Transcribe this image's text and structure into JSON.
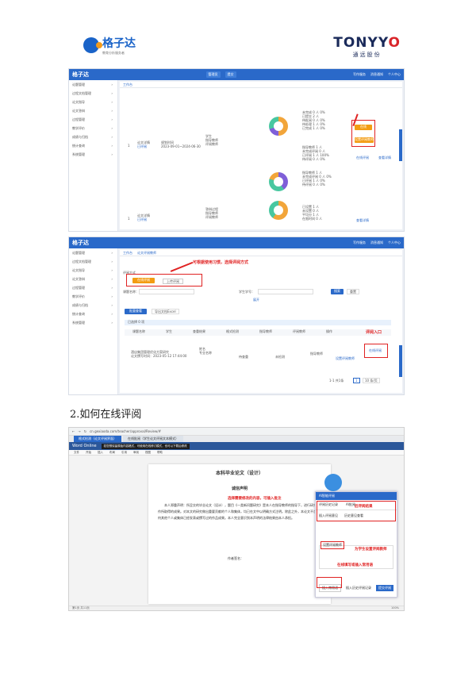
{
  "header": {
    "left_logo_text": "格子达",
    "left_logo_sub": "教育分析服务者",
    "right_logo_text": "TONYYO",
    "right_logo_sub": "通远股份"
  },
  "shot1": {
    "brand": "格子达",
    "topbar_items": [
      "管理员",
      "提交"
    ],
    "topbar_right": [
      "写作服务",
      "消息通知",
      "个人中心"
    ],
    "sidebar": [
      "论题管理",
      "过程文档管理",
      "论文指导",
      "论文答辩",
      "过程管理",
      "教学评价",
      "成绩与归档",
      "统计查询",
      "系统管理"
    ],
    "tab": "工作台",
    "row1": {
      "num": "1",
      "title": "论文详情",
      "status": "已评阅",
      "plan": "规划时间",
      "date": "2023-09-01~2024-06-30"
    },
    "row1_legend": [
      "学生",
      "指导教师",
      "评阅教师"
    ],
    "row1_stats": [
      "未完成 0 人  0%",
      "已提交 2 人",
      "待批阅 0 人  0%",
      "待处理 1 人  0%",
      "已完成 1 人  0%"
    ],
    "row1_stats2": [
      "指导教师 1 人",
      "未完成评阅 0 人",
      "已评阅 1 人  100%",
      "待评阅 0 人  0%"
    ],
    "btn_review": "在线",
    "btn_set_reviewer": "设置评阅教师",
    "link_review": "在线评阅",
    "link_detail": "查看详情",
    "row2": {
      "num": "1",
      "title": "论文详情",
      "status": "已评阅"
    },
    "row2_legend": [
      "答辩过程",
      "指导教师",
      "评阅教师"
    ],
    "row2_stats": [
      "指导教师 1 人",
      "未完成评阅 0 人  0%",
      "已评阅 1 人  0%",
      "待评阅 0 人  0%"
    ],
    "row2_stats2": [
      "已设置 1 人",
      "未设置 0 人",
      "平均分 1 人",
      "在限时间 0 人"
    ],
    "link_detail2": "查看详情"
  },
  "shot2": {
    "brand": "格子达",
    "topbar_right": [
      "写作服务",
      "消息通知",
      "个人中心"
    ],
    "sidebar": [
      "论题管理",
      "过程文档管理",
      "论文指导",
      "论文答辩",
      "过程管理",
      "教学评价",
      "成绩与归档",
      "统计查询",
      "系统管理"
    ],
    "tabs": [
      "工作台",
      "论文评阅教师"
    ],
    "annotation1": "可根据使用习惯，选择评阅方式",
    "mode_label": "评阅方式",
    "btn_online": "在线评阅",
    "btn_upload": "上传评阅",
    "filter_label1": "课题名称：",
    "filter_label2": "学生学号：",
    "btn_search": "搜索",
    "btn_reset": "重置",
    "expand": "展开",
    "btn_batch": "批量查看",
    "btn_export": "导出文档Excel",
    "count_text": "已选择 0 项",
    "table_headers": [
      "课题名称",
      "学生",
      "查重结果",
      "格式检测",
      "指导教师",
      "评阅教师",
      "操作"
    ],
    "annotation2": "评阅入口",
    "row": {
      "title": "酒店集团管理优化方案研究",
      "sub": "论文撰写时间：2023-05-12 17:44:00",
      "student": "姓名",
      "student2": "专业名称",
      "result": "待查重",
      "format": "未检测",
      "advisor": "指导教师",
      "reviewer": "设置评阅教师",
      "action": "在线评阅"
    },
    "pagination": "1-1 共1条",
    "page": "1",
    "page_size": "10 条/页"
  },
  "section_title": "2.如何在线评阅",
  "shot3": {
    "url": "cn.gexiaoda.com/teacher/approval/Review/#",
    "tabs": [
      "格式检测（论文评阅界面）",
      "在线批阅（学生论文评阅文本模式）"
    ],
    "word_label": "Word Online",
    "ribbon_items": [
      "文件",
      "开始",
      "插入",
      "布局",
      "引用",
      "审阅",
      "视图",
      "帮助"
    ],
    "notice": "若您想保留原始内容格式，可使用在线修订模式，也可以下载后修改",
    "doc_title": "本科毕业论文（设计）",
    "doc_heading": "诚信声明",
    "doc_body": "本人郑重声明：所呈交的毕业论文（设计），题目《一类新问题研究》是本人在指导教师的指导下，进行研究工作所取得的成果。对本文的研究做出重要贡献的个人和集体，均已在文中以明确方式注明。除此之外，本论文不含任何其他个人或集体已经发表或撰写过的作品成果。本人完全意识到本声明的法律结果由本人承担。",
    "doc_sign": "作者签名：",
    "ann_select": "选择需要修改的内容，可插入批注",
    "ann_score": "后评阅结果",
    "ann_set": "为学生设置评阅教师",
    "ann_common": "在线填写或插入常用语",
    "panel_title": "AI智能评阅",
    "panel_tab1": "评阅历史记录",
    "panel_tab2": "AI批阅",
    "panel_items": [
      "插入评阅意见",
      "历史意见查看"
    ],
    "panel_set": "设置评阅教师",
    "panel_insert": "插入常用语",
    "panel_insert2": "插入历史评阅记录",
    "panel_submit": "提交评阅",
    "status_left": "第1页 共11页",
    "status_right": "100%"
  }
}
